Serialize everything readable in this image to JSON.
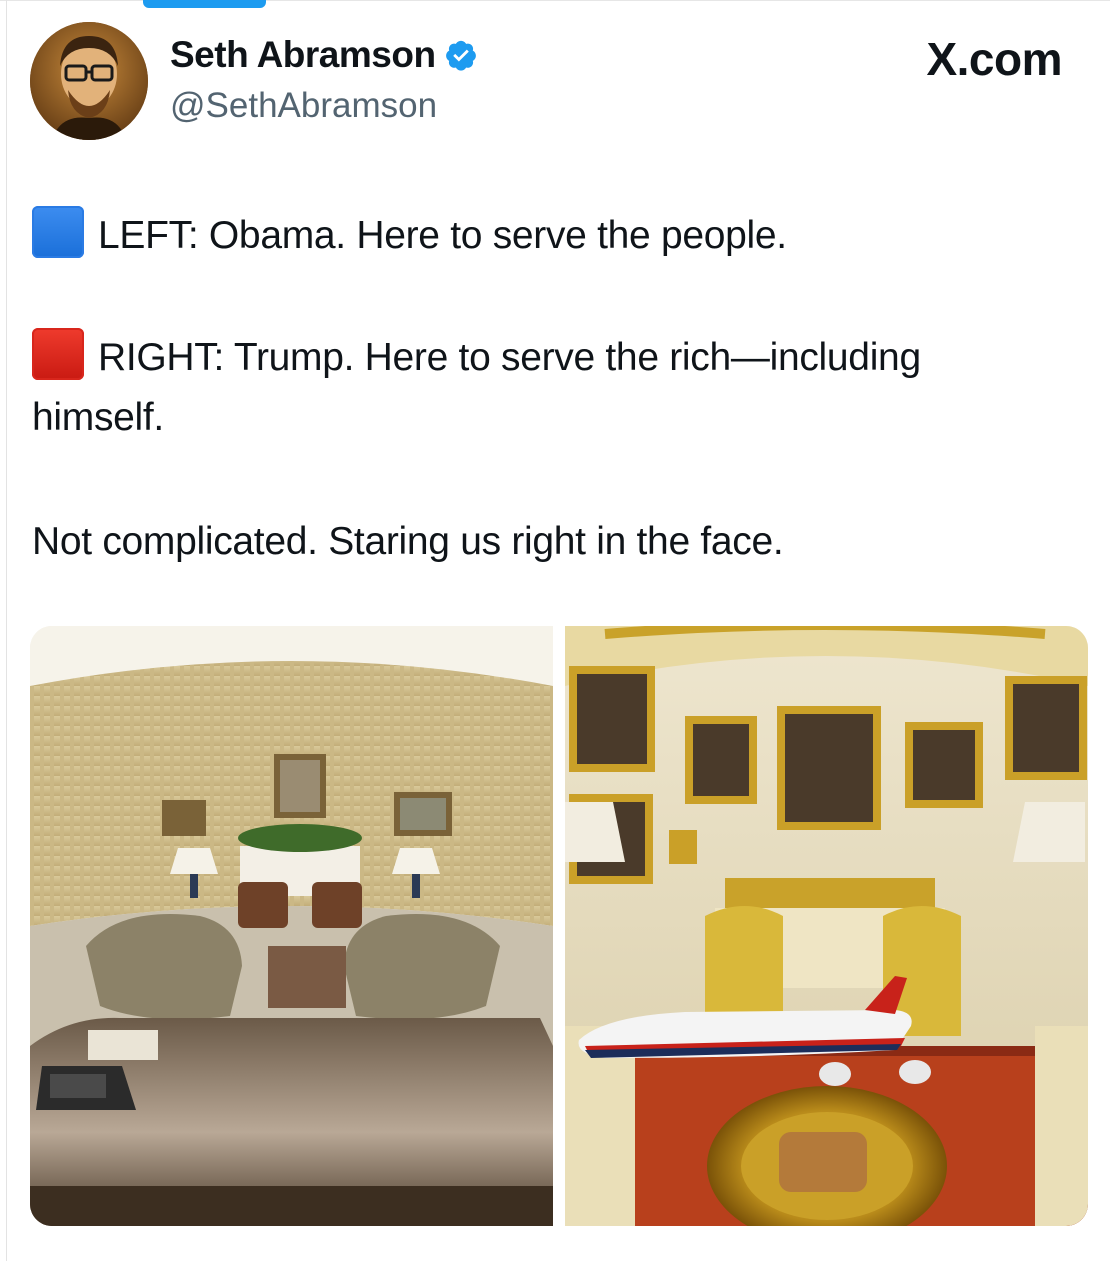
{
  "header": {
    "display_name": "Seth Abramson",
    "handle": "@SethAbramson",
    "brand": "X.com",
    "verified_icon": "verified-badge-icon",
    "avatar_icon": "avatar"
  },
  "tweet": {
    "left_marker_icon": "blue-square",
    "left_line": "LEFT: Obama. Here to serve the people.",
    "right_marker_icon": "red-square",
    "right_line_1": "RIGHT: Trump. Here to serve the rich—including",
    "right_line_2": "himself.",
    "closing_line": "Not complicated. Staring us right in the face."
  },
  "media": {
    "left_photo": "oval-office-obama-photo",
    "right_photo": "oval-office-trump-photo"
  },
  "colors": {
    "accent": "#1d9bf0",
    "text": "#0f1419",
    "secondary_text": "#536471",
    "blue_square": "#1a6fd9",
    "red_square": "#d8261c"
  }
}
